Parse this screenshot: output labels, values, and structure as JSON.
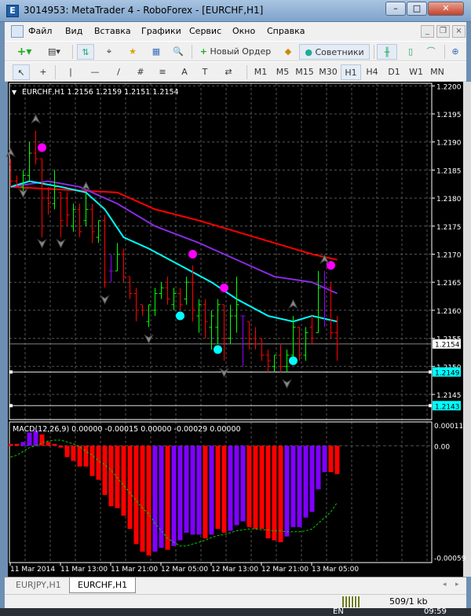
{
  "window": {
    "title": "3014953: MetaTrader 4 - RoboForex - [EURCHF,H1]",
    "minimize": "–",
    "maximize": "□",
    "close": "✕"
  },
  "menu": {
    "items": [
      "Файл",
      "Вид",
      "Вставка",
      "Графики",
      "Сервис",
      "Окно",
      "Справка"
    ]
  },
  "toolbar1": {
    "new_order": "Новый Ордер",
    "experts": "Советники"
  },
  "toolbar2": {
    "tools": [
      "↖",
      "+",
      "|",
      "—",
      "/",
      "#",
      "≡",
      "A",
      "T",
      "⇄"
    ],
    "timeframes": [
      "M1",
      "M5",
      "M15",
      "M30",
      "H1",
      "H4",
      "D1",
      "W1",
      "MN"
    ],
    "active_timeframe": "H1"
  },
  "chart": {
    "header": "EURCHF,H1  1.2156 1.2159 1.2151 1.2154",
    "price_ticks": [
      "1.2200",
      "1.2195",
      "1.2190",
      "1.2185",
      "1.2180",
      "1.2175",
      "1.2170",
      "1.2165",
      "1.2160",
      "1.2155",
      "1.2150",
      "1.2145"
    ],
    "current_price": "1.2154",
    "line_labels": [
      "1.2149",
      "1.2143"
    ],
    "time_labels": [
      "11 Mar 2014",
      "11 Mar 13:00",
      "11 Mar 21:00",
      "12 Mar 05:00",
      "12 Mar 13:00",
      "12 Mar 21:00",
      "13 Mar 05:00"
    ],
    "macd_header": "MACD(12,26,9) 0.00000 -0.00015 0.00000 -0.00029 0.00000",
    "macd_ticks": [
      "0.00011",
      "0.00",
      "-0.00059"
    ],
    "colors": {
      "bull": "#00ff00",
      "bear": "#ff0000",
      "doji": "#9900ff",
      "ma_slow": "#ff0000",
      "ma_mid": "#8a2be2",
      "ma_fast": "#00ffff",
      "buy_dot": "#ff00ff",
      "sell_dot": "#00ffff",
      "macd_up": "#8000ff",
      "macd_down": "#ff0000",
      "signal": "#00cc00"
    }
  },
  "chart_data": {
    "type": "candlestick-ohlc",
    "symbol": "EURCHF",
    "timeframe": "H1",
    "ylim": [
      1.2141,
      1.22
    ],
    "bars": [
      [
        1.2186,
        1.2187,
        1.2182,
        1.2183
      ],
      [
        1.2183,
        1.2184,
        1.2182,
        1.2182
      ],
      [
        1.2182,
        1.2185,
        1.2181,
        1.2184
      ],
      [
        1.2184,
        1.219,
        1.2183,
        1.2188
      ],
      [
        1.2188,
        1.2192,
        1.2186,
        1.2187
      ],
      [
        1.2187,
        1.2187,
        1.2173,
        1.218
      ],
      [
        1.218,
        1.2182,
        1.2177,
        1.2179
      ],
      [
        1.2179,
        1.2185,
        1.2178,
        1.2182
      ],
      [
        1.2181,
        1.2181,
        1.2173,
        1.2176
      ],
      [
        1.218,
        1.2181,
        1.2175,
        1.2177
      ],
      [
        1.2175,
        1.2179,
        1.2174,
        1.2178
      ],
      [
        1.2178,
        1.2179,
        1.2173,
        1.2174
      ],
      [
        1.2176,
        1.2181,
        1.2175,
        1.2178
      ],
      [
        1.2178,
        1.2179,
        1.2172,
        1.2174
      ],
      [
        1.2173,
        1.2176,
        1.2172,
        1.2176
      ],
      [
        1.2176,
        1.2177,
        1.2164,
        1.2165
      ],
      [
        1.2167,
        1.217,
        1.2165,
        1.2167
      ],
      [
        1.2167,
        1.2172,
        1.2167,
        1.217
      ],
      [
        1.217,
        1.2171,
        1.2165,
        1.2166
      ],
      [
        1.2166,
        1.2166,
        1.2162,
        1.2163
      ],
      [
        1.2163,
        1.2164,
        1.2158,
        1.216
      ],
      [
        1.2161,
        1.2161,
        1.2159,
        1.216
      ],
      [
        1.2158,
        1.2161,
        1.2157,
        1.2161
      ],
      [
        1.216,
        1.2164,
        1.2159,
        1.2163
      ],
      [
        1.2163,
        1.2165,
        1.2162,
        1.2164
      ],
      [
        1.2164,
        1.2166,
        1.2161,
        1.2162
      ],
      [
        1.2161,
        1.2164,
        1.216,
        1.2163
      ],
      [
        1.2163,
        1.2164,
        1.216,
        1.2161
      ],
      [
        1.2162,
        1.2166,
        1.2161,
        1.2165
      ],
      [
        1.2165,
        1.2168,
        1.2158,
        1.216
      ],
      [
        1.2159,
        1.2162,
        1.2156,
        1.2161
      ],
      [
        1.2161,
        1.2162,
        1.2155,
        1.2158
      ],
      [
        1.2157,
        1.216,
        1.2153,
        1.2159
      ],
      [
        1.2157,
        1.2162,
        1.2154,
        1.2161
      ],
      [
        1.2161,
        1.2161,
        1.2151,
        1.2155
      ],
      [
        1.2155,
        1.2161,
        1.2154,
        1.2159
      ],
      [
        1.2159,
        1.2166,
        1.2156,
        1.2161
      ],
      [
        1.2159,
        1.2159,
        1.215,
        1.2159
      ],
      [
        1.2158,
        1.2158,
        1.2153,
        1.2155
      ],
      [
        1.2155,
        1.2157,
        1.2153,
        1.2154
      ],
      [
        1.2155,
        1.2155,
        1.2151,
        1.2152
      ],
      [
        1.2152,
        1.2153,
        1.2149,
        1.2151
      ],
      [
        1.215,
        1.2152,
        1.2149,
        1.2152
      ],
      [
        1.2152,
        1.2154,
        1.2149,
        1.215
      ],
      [
        1.215,
        1.2153,
        1.2149,
        1.2152
      ],
      [
        1.2152,
        1.2159,
        1.2151,
        1.2157
      ],
      [
        1.2157,
        1.2157,
        1.2151,
        1.2152
      ],
      [
        1.2152,
        1.2157,
        1.2151,
        1.2156
      ],
      [
        1.2157,
        1.2159,
        1.2154,
        1.2155
      ],
      [
        1.2156,
        1.2167,
        1.2156,
        1.2164
      ],
      [
        1.2164,
        1.2167,
        1.2157,
        1.2164
      ],
      [
        1.2164,
        1.2165,
        1.2155,
        1.2156
      ],
      [
        1.2156,
        1.2159,
        1.2151,
        1.2154
      ]
    ],
    "ma": [
      {
        "name": "ma_slow",
        "points": [
          [
            0,
            1.2182
          ],
          [
            17,
            1.2181
          ],
          [
            23,
            1.2178
          ],
          [
            30,
            1.2176
          ],
          [
            36,
            1.2174
          ],
          [
            42,
            1.2172
          ],
          [
            48,
            1.217
          ],
          [
            52,
            1.2169
          ]
        ]
      },
      {
        "name": "ma_mid",
        "points": [
          [
            0,
            1.2182
          ],
          [
            6,
            1.2183
          ],
          [
            11,
            1.2182
          ],
          [
            17,
            1.2179
          ],
          [
            23,
            1.2175
          ],
          [
            30,
            1.2172
          ],
          [
            36,
            1.2169
          ],
          [
            42,
            1.2166
          ],
          [
            48,
            1.2165
          ],
          [
            52,
            1.2163
          ]
        ]
      },
      {
        "name": "ma_fast",
        "points": [
          [
            0,
            1.2182
          ],
          [
            3,
            1.2183
          ],
          [
            8,
            1.2182
          ],
          [
            12,
            1.2181
          ],
          [
            15,
            1.2178
          ],
          [
            18,
            1.2173
          ],
          [
            22,
            1.2171
          ],
          [
            27,
            1.2168
          ],
          [
            32,
            1.2165
          ],
          [
            36,
            1.2162
          ],
          [
            41,
            1.2159
          ],
          [
            45,
            1.2158
          ],
          [
            48,
            1.2159
          ],
          [
            52,
            1.2158
          ]
        ]
      }
    ],
    "buy_dots": [
      [
        5,
        1.2189
      ],
      [
        29,
        1.217
      ],
      [
        34,
        1.2164
      ],
      [
        51,
        1.2168
      ]
    ],
    "sell_dots": [
      [
        27,
        1.2159
      ],
      [
        33,
        1.2153
      ],
      [
        45,
        1.2151
      ]
    ],
    "up_arrows": [
      [
        0,
        1.2188
      ],
      [
        4,
        1.2194
      ],
      [
        12,
        1.2182
      ],
      [
        45,
        1.2161
      ],
      [
        50,
        1.2169
      ]
    ],
    "down_arrows": [
      [
        2,
        1.2181
      ],
      [
        5,
        1.2172
      ],
      [
        8,
        1.2172
      ],
      [
        15,
        1.2162
      ],
      [
        22,
        1.2155
      ],
      [
        34,
        1.2149
      ],
      [
        44,
        1.2147
      ]
    ],
    "hlines": [
      1.2154,
      1.2149,
      1.2143
    ],
    "macd": {
      "ylim": [
        -0.00059,
        0.00011
      ],
      "histogram": [
        1e-05,
        1e-05,
        2e-05,
        7e-05,
        8e-05,
        6e-05,
        2e-05,
        1e-05,
        -1e-05,
        -6e-05,
        -8e-05,
        -0.00011,
        -0.00011,
        -0.00016,
        -0.00018,
        -0.00026,
        -0.00032,
        -0.00033,
        -0.00037,
        -0.00044,
        -0.00052,
        -0.00056,
        -0.00058,
        -0.00056,
        -0.00054,
        -0.00055,
        -0.00053,
        -0.0005,
        -0.00046,
        -0.00047,
        -0.00047,
        -0.00049,
        -0.00047,
        -0.00044,
        -0.00046,
        -0.00045,
        -0.00042,
        -0.0004,
        -0.00043,
        -0.00044,
        -0.00044,
        -0.00049,
        -0.0005,
        -0.00051,
        -0.00048,
        -0.00043,
        -0.00043,
        -0.00038,
        -0.00035,
        -0.00023,
        -0.00014,
        -0.00014,
        -0.00015
      ],
      "colors": [
        "d",
        "d",
        "u",
        "u",
        "u",
        "d",
        "d",
        "d",
        "d",
        "d",
        "d",
        "d",
        "d",
        "d",
        "d",
        "d",
        "d",
        "d",
        "d",
        "d",
        "d",
        "d",
        "d",
        "u",
        "u",
        "d",
        "u",
        "u",
        "u",
        "u",
        "u",
        "d",
        "u",
        "d",
        "d",
        "u",
        "u",
        "u",
        "d",
        "d",
        "d",
        "d",
        "d",
        "d",
        "u",
        "u",
        "u",
        "u",
        "u",
        "u",
        "u",
        "d",
        "d"
      ],
      "signal": [
        -6e-05,
        -5e-05,
        -3e-05,
        -1e-05,
        0,
        1.5e-05,
        2.5e-05,
        3e-05,
        3e-05,
        2e-05,
        1e-05,
        -5e-06,
        -3e-05,
        -5e-05,
        -8e-05,
        -0.0001,
        -0.00013,
        -0.00017,
        -0.00021,
        -0.00025,
        -0.00029,
        -0.00033,
        -0.00036,
        -0.00041,
        -0.00045,
        -0.00049,
        -0.00051,
        -0.00053,
        -0.00053,
        -0.00052,
        -0.00051,
        -0.0005,
        -0.000485,
        -0.000475,
        -0.00047,
        -0.00046,
        -0.00045,
        -0.000445,
        -0.00044,
        -0.00044,
        -0.000445,
        -0.000445,
        -0.00045,
        -0.00045,
        -0.000455,
        -0.000455,
        -0.000455,
        -0.00045,
        -0.00044,
        -0.00041,
        -0.00038,
        -0.00035,
        -0.0003
      ]
    }
  },
  "tabs": [
    {
      "label": "EURJPY,H1"
    },
    {
      "label": "EURCHF,H1",
      "active": true
    }
  ],
  "status": {
    "traffic": "509/1 kb"
  },
  "taskbar": {
    "lang": "EN",
    "clock": "09:59"
  }
}
